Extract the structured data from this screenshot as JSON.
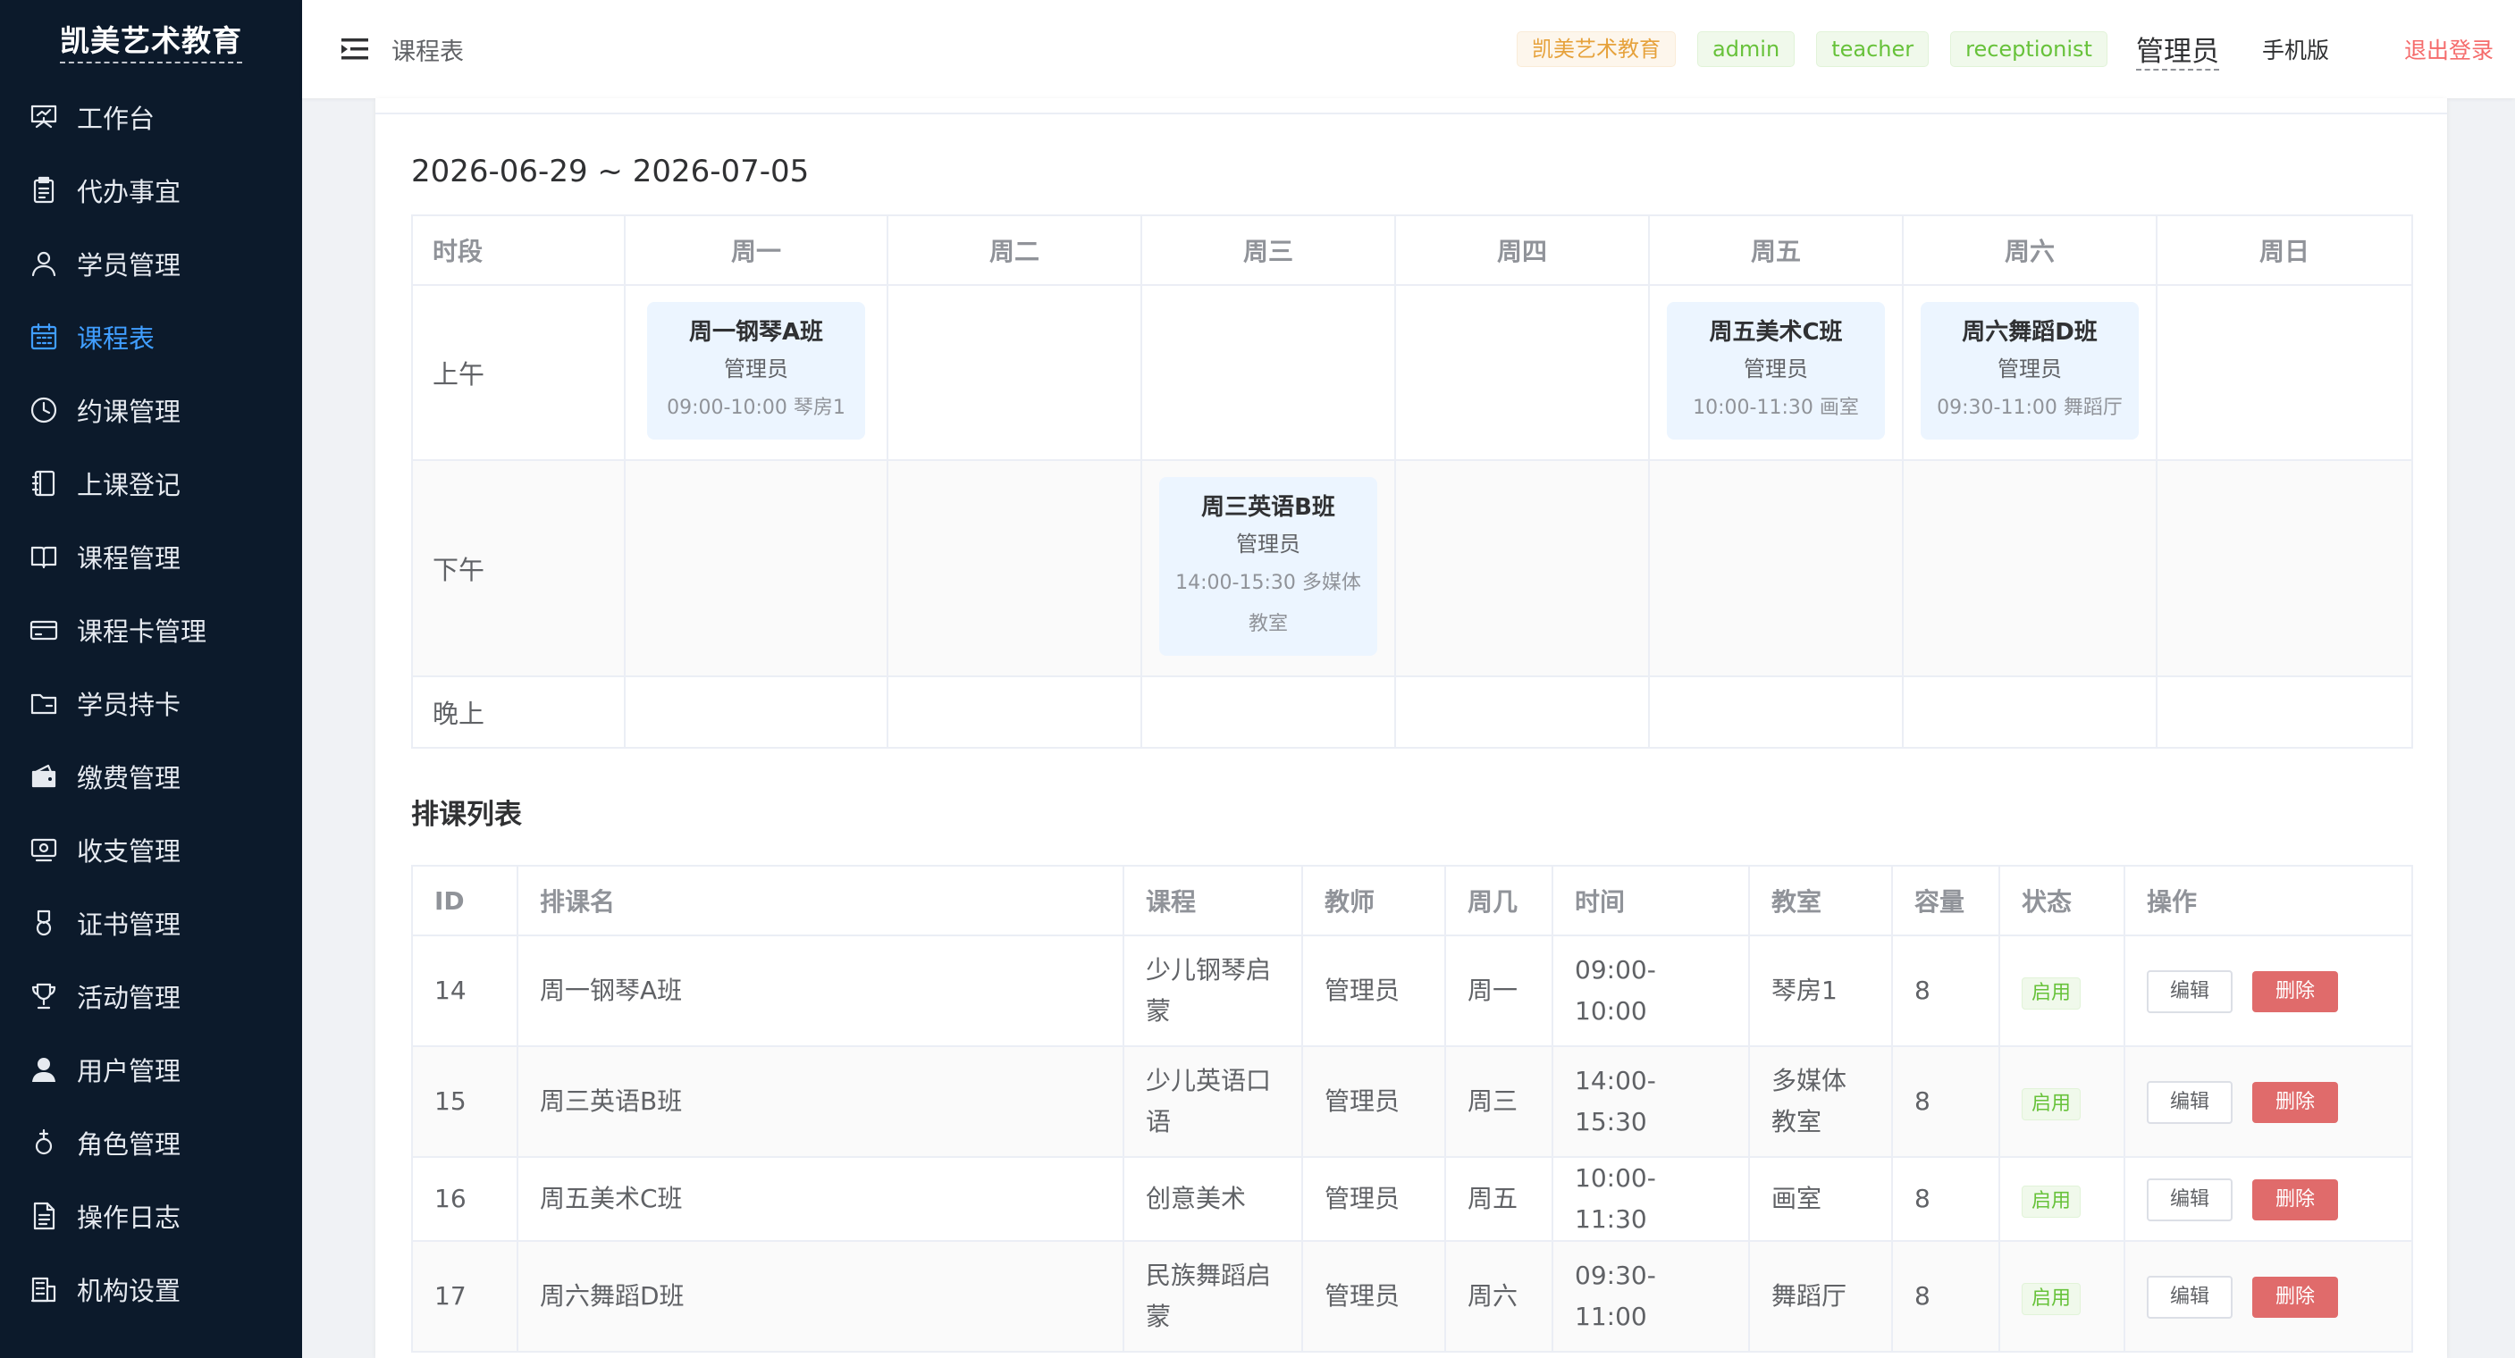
{
  "brand": "凯美艺术教育",
  "sidebar": {
    "items": [
      {
        "label": "工作台",
        "icon": "presentation-board-icon",
        "active": false
      },
      {
        "label": "代办事宜",
        "icon": "clipboard-icon",
        "active": false
      },
      {
        "label": "学员管理",
        "icon": "user-icon",
        "active": false
      },
      {
        "label": "课程表",
        "icon": "calendar-icon",
        "active": true
      },
      {
        "label": "约课管理",
        "icon": "clock-icon",
        "active": false
      },
      {
        "label": "上课登记",
        "icon": "notebook-icon",
        "active": false
      },
      {
        "label": "课程管理",
        "icon": "open-book-icon",
        "active": false
      },
      {
        "label": "课程卡管理",
        "icon": "credit-card-icon",
        "active": false
      },
      {
        "label": "学员持卡",
        "icon": "folder-icon",
        "active": false
      },
      {
        "label": "缴费管理",
        "icon": "wallet-icon",
        "active": false
      },
      {
        "label": "收支管理",
        "icon": "money-icon",
        "active": false
      },
      {
        "label": "证书管理",
        "icon": "medal-icon",
        "active": false
      },
      {
        "label": "活动管理",
        "icon": "trophy-icon",
        "active": false
      },
      {
        "label": "用户管理",
        "icon": "user-filled-icon",
        "active": false
      },
      {
        "label": "角色管理",
        "icon": "female-icon",
        "active": false
      },
      {
        "label": "操作日志",
        "icon": "document-icon",
        "active": false
      },
      {
        "label": "机构设置",
        "icon": "office-building-icon",
        "active": false
      }
    ]
  },
  "header": {
    "page_title": "课程表",
    "org_tag": "凯美艺术教育",
    "role_tags": [
      "admin",
      "teacher",
      "receptionist"
    ],
    "current_user": "管理员",
    "mobile_link": "手机版",
    "logout": "退出登录"
  },
  "schedule": {
    "week_range": "2026-06-29 ~ 2026-07-05",
    "slot_header": "时段",
    "days": [
      "周一",
      "周二",
      "周三",
      "周四",
      "周五",
      "周六",
      "周日"
    ],
    "slots": [
      {
        "label": "上午",
        "cells": [
          {
            "name": "周一钢琴A班",
            "teacher": "管理员",
            "meta": "09:00-10:00 琴房1"
          },
          null,
          null,
          null,
          {
            "name": "周五美术C班",
            "teacher": "管理员",
            "meta": "10:00-11:30 画室"
          },
          {
            "name": "周六舞蹈D班",
            "teacher": "管理员",
            "meta": "09:30-11:00 舞蹈厅"
          },
          null
        ]
      },
      {
        "label": "下午",
        "cells": [
          null,
          null,
          {
            "name": "周三英语B班",
            "teacher": "管理员",
            "meta": "14:00-15:30 多媒体教室"
          },
          null,
          null,
          null,
          null
        ]
      },
      {
        "label": "晚上",
        "cells": [
          null,
          null,
          null,
          null,
          null,
          null,
          null
        ]
      }
    ]
  },
  "list": {
    "title": "排课列表",
    "columns": [
      "ID",
      "排课名",
      "课程",
      "教师",
      "周几",
      "时间",
      "教室",
      "容量",
      "状态",
      "操作"
    ],
    "edit_label": "编辑",
    "delete_label": "删除",
    "rows": [
      {
        "id": "14",
        "name": "周一钢琴A班",
        "course": "少儿钢琴启蒙",
        "teacher": "管理员",
        "weekday": "周一",
        "time": "09:00-10:00",
        "room": "琴房1",
        "capacity": "8",
        "status": "启用"
      },
      {
        "id": "15",
        "name": "周三英语B班",
        "course": "少儿英语口语",
        "teacher": "管理员",
        "weekday": "周三",
        "time": "14:00-15:30",
        "room": "多媒体教室",
        "capacity": "8",
        "status": "启用"
      },
      {
        "id": "16",
        "name": "周五美术C班",
        "course": "创意美术",
        "teacher": "管理员",
        "weekday": "周五",
        "time": "10:00-11:30",
        "room": "画室",
        "capacity": "8",
        "status": "启用"
      },
      {
        "id": "17",
        "name": "周六舞蹈D班",
        "course": "民族舞蹈启蒙",
        "teacher": "管理员",
        "weekday": "周六",
        "time": "09:30-11:00",
        "room": "舞蹈厅",
        "capacity": "8",
        "status": "启用"
      }
    ]
  },
  "colors": {
    "sidebar_bg": "#0c1a2b",
    "active": "#409eff",
    "danger": "#e06b6b",
    "success": "#67c23a",
    "warning": "#e6a23c"
  }
}
